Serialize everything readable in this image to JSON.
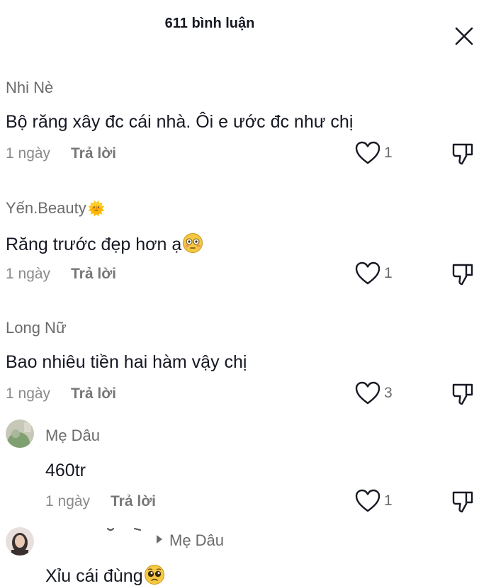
{
  "header": {
    "title": "611 bình luận",
    "close_icon": "close-icon"
  },
  "comments": [
    {
      "username": "Nhi Nè",
      "text": "Bộ răng xây đc cái nhà. Ôi e ước đc như chị",
      "time": "1 ngày",
      "reply_label": "Trả lời",
      "likes": "1"
    },
    {
      "username": "Yến.Beauty",
      "badge_icon": "sun-icon",
      "text": "Răng trước đẹp hơn ạ",
      "text_emoji": "flushed-face-icon",
      "time": "1 ngày",
      "reply_label": "Trả lời",
      "likes": "1"
    },
    {
      "username": "Long Nữ",
      "text": "Bao nhiêu tiền hai hàm vậy chị",
      "time": "1 ngày",
      "reply_label": "Trả lời",
      "likes": "3"
    }
  ],
  "replies": [
    {
      "username": "Mẹ Dâu",
      "text": "460tr",
      "time": "1 ngày",
      "reply_label": "Trả lời",
      "likes": "1"
    },
    {
      "reply_to": "Mẹ Dâu",
      "text": "Xỉu cái đùng",
      "text_emoji": "pleading-face-icon"
    }
  ],
  "icons": {
    "like": "heart-icon",
    "dislike": "thumbs-down-icon",
    "reply_arrow": "reply-arrow-icon"
  },
  "colors": {
    "text": "#161823",
    "secondary": "#6b6b6b",
    "background": "#ffffff"
  }
}
